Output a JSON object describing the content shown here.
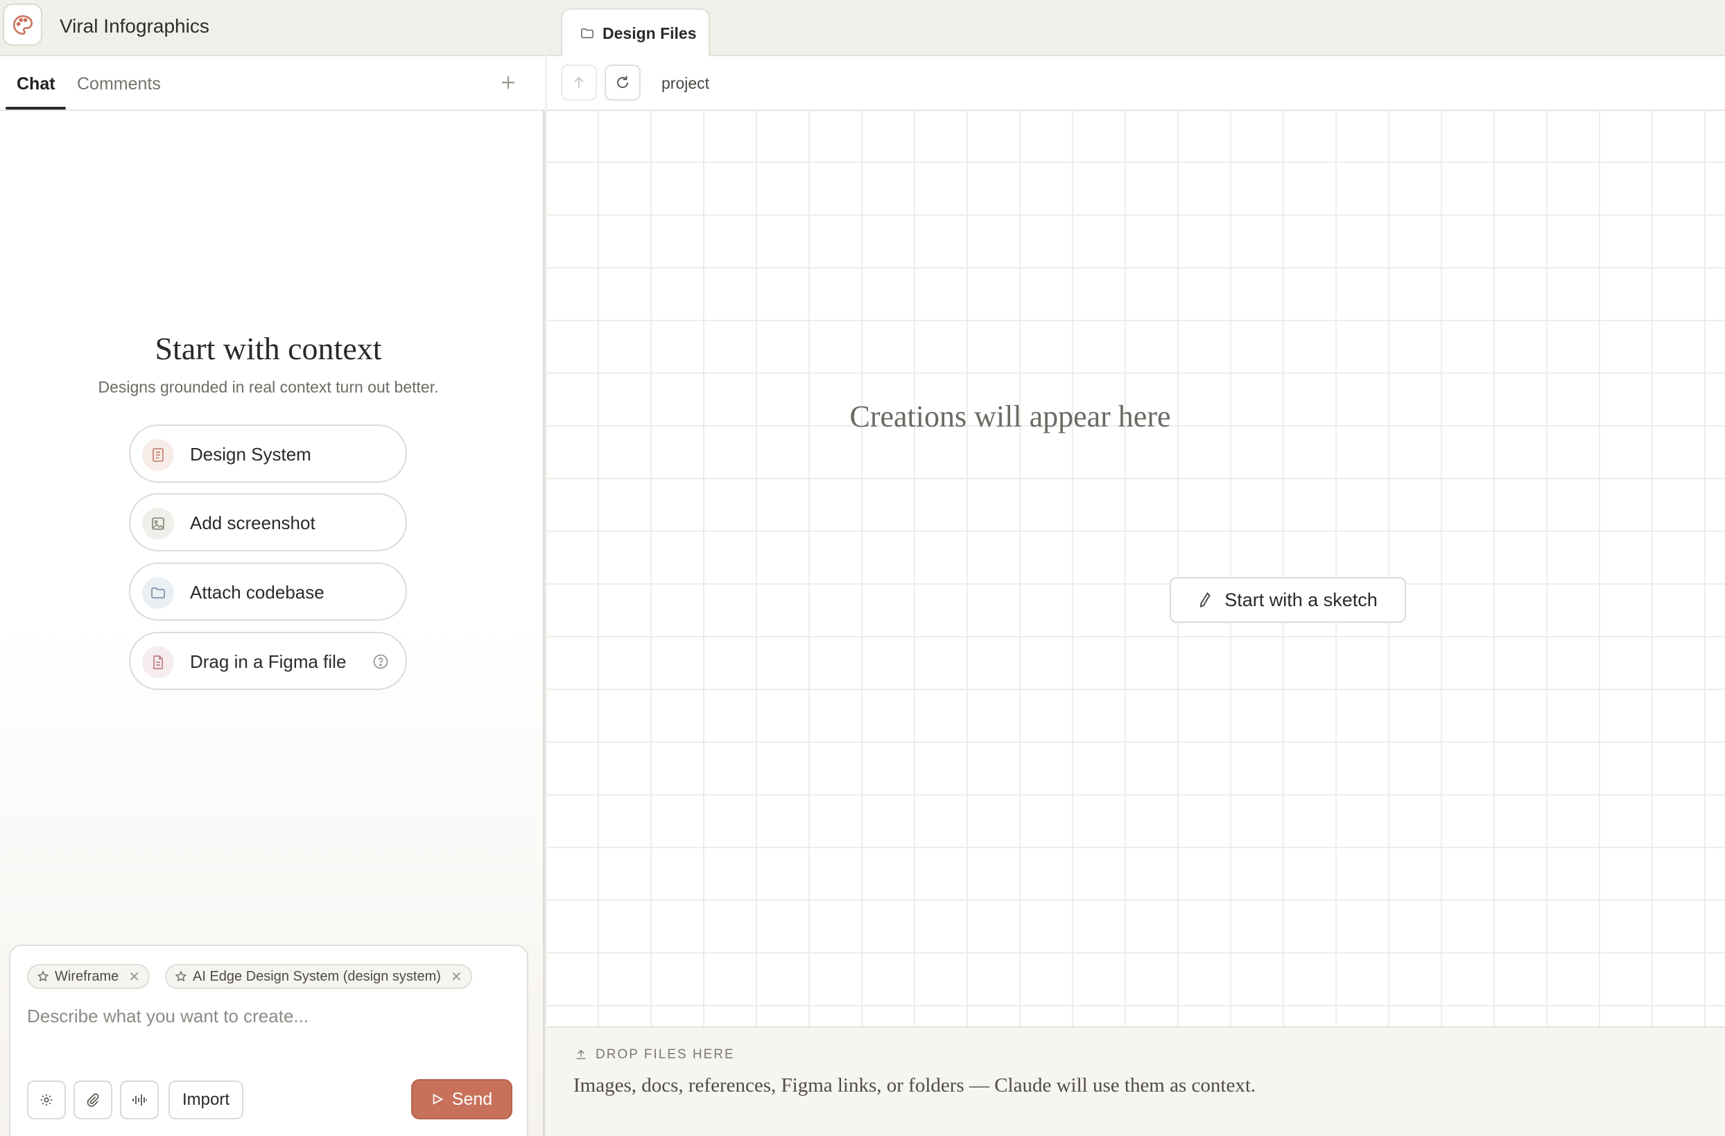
{
  "app": {
    "title": "Viral Infographics"
  },
  "left_tabs": [
    {
      "label": "Chat",
      "active": true
    },
    {
      "label": "Comments",
      "active": false
    }
  ],
  "context": {
    "title": "Start with context",
    "subtitle": "Designs grounded in real context turn out better.",
    "options": [
      {
        "label": "Design System",
        "icon": "design-system-icon",
        "tint": "#f8ece8"
      },
      {
        "label": "Add screenshot",
        "icon": "image-icon",
        "tint": "#eef0ea"
      },
      {
        "label": "Attach codebase",
        "icon": "folder-icon",
        "tint": "#eaeff4"
      },
      {
        "label": "Drag in a Figma file",
        "icon": "document-icon",
        "tint": "#f6ecee"
      }
    ]
  },
  "composer": {
    "chips": [
      {
        "label": "Wireframe",
        "icon": "star-icon"
      },
      {
        "label": "AI Edge Design System (design system)",
        "icon": "star-icon"
      }
    ],
    "placeholder": "Describe what you want to create...",
    "import_label": "Import",
    "send_label": "Send",
    "send_color": "#c7715a"
  },
  "right": {
    "file_tab": "Design Files",
    "path": "project",
    "empty_title": "Creations will appear here",
    "sketch_label": "Start with a sketch"
  },
  "dropzone": {
    "label": "DROP FILES HERE",
    "description": "Images, docs, references, Figma links, or folders — Claude will use them as context."
  },
  "colors": {
    "accent": "#c7715a",
    "logo": "#c7715a"
  }
}
